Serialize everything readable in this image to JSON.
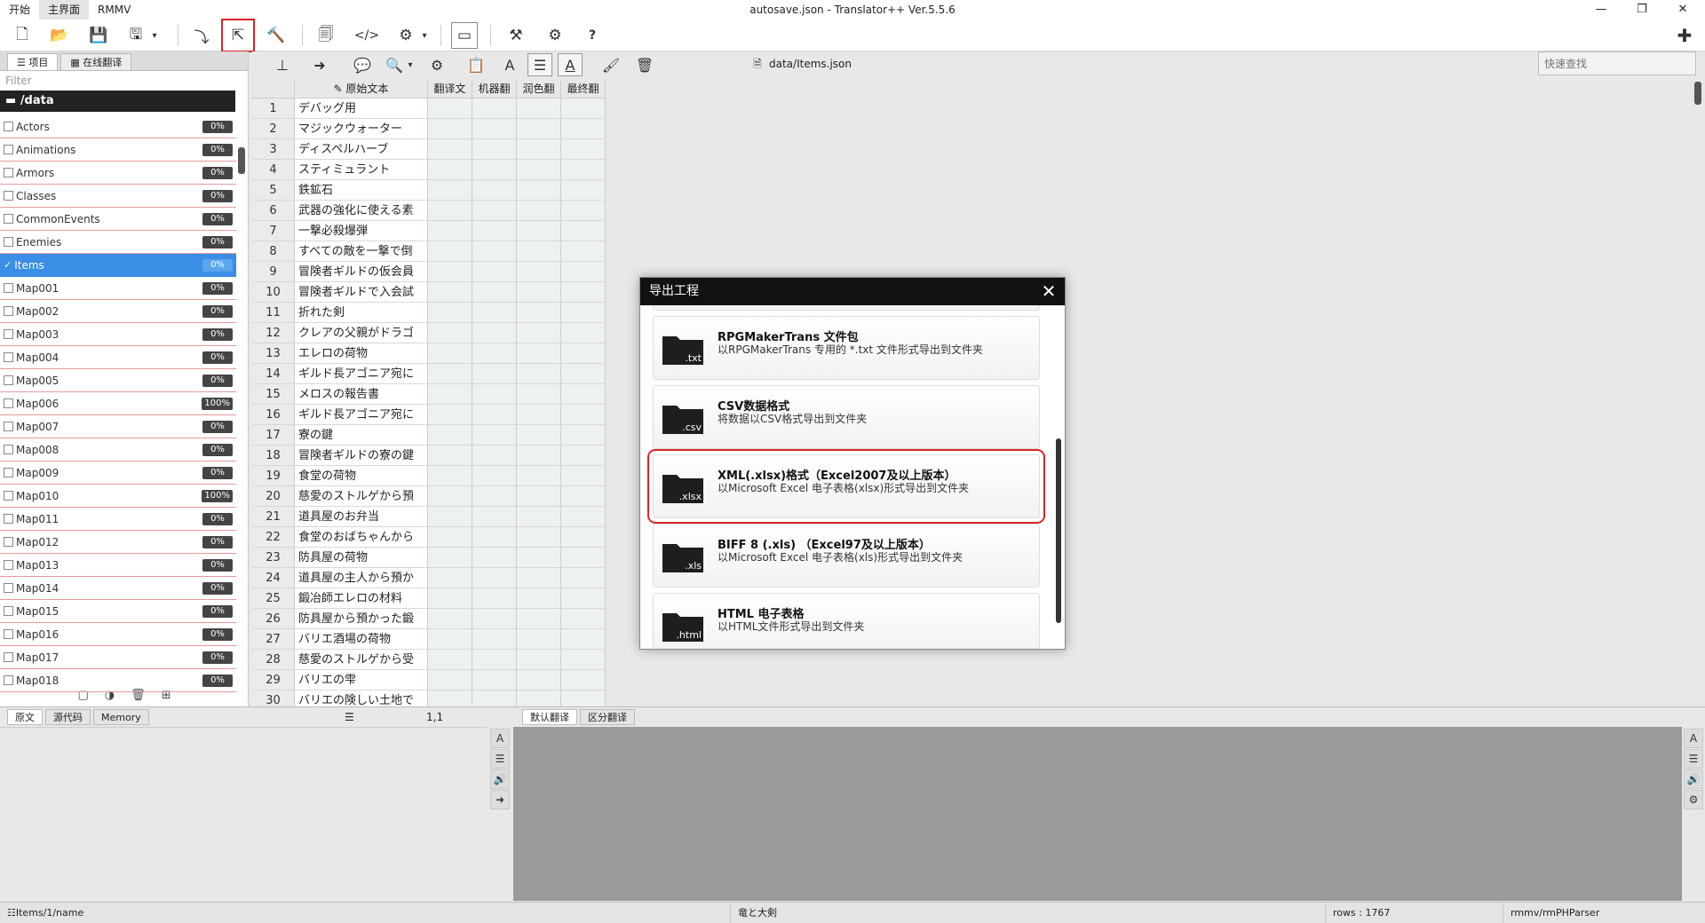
{
  "menu": {
    "items": [
      "开始",
      "主界面",
      "RMMV"
    ]
  },
  "window": {
    "title": "autosave.json - Translator++ Ver.5.5.6"
  },
  "left": {
    "tabs": [
      "项目",
      "在线翻译"
    ],
    "filter_placeholder": "Filter",
    "folder": "/data",
    "files": [
      {
        "name": "Actors",
        "pct": "0%"
      },
      {
        "name": "Animations",
        "pct": "0%"
      },
      {
        "name": "Armors",
        "pct": "0%"
      },
      {
        "name": "Classes",
        "pct": "0%"
      },
      {
        "name": "CommonEvents",
        "pct": "0%"
      },
      {
        "name": "Enemies",
        "pct": "0%"
      },
      {
        "name": "Items",
        "pct": "0%"
      },
      {
        "name": "Map001",
        "pct": "0%"
      },
      {
        "name": "Map002",
        "pct": "0%"
      },
      {
        "name": "Map003",
        "pct": "0%"
      },
      {
        "name": "Map004",
        "pct": "0%"
      },
      {
        "name": "Map005",
        "pct": "0%"
      },
      {
        "name": "Map006",
        "pct": "100%"
      },
      {
        "name": "Map007",
        "pct": "0%"
      },
      {
        "name": "Map008",
        "pct": "0%"
      },
      {
        "name": "Map009",
        "pct": "0%"
      },
      {
        "name": "Map010",
        "pct": "100%"
      },
      {
        "name": "Map011",
        "pct": "0%"
      },
      {
        "name": "Map012",
        "pct": "0%"
      },
      {
        "name": "Map013",
        "pct": "0%"
      },
      {
        "name": "Map014",
        "pct": "0%"
      },
      {
        "name": "Map015",
        "pct": "0%"
      },
      {
        "name": "Map016",
        "pct": "0%"
      },
      {
        "name": "Map017",
        "pct": "0%"
      },
      {
        "name": "Map018",
        "pct": "0%"
      }
    ]
  },
  "toolbar2": {
    "path": "data/Items.json",
    "quick_search_placeholder": "快速查找"
  },
  "grid": {
    "headers": [
      "原始文本",
      "翻译文",
      "机器翻",
      "润色翻",
      "最终翻"
    ],
    "rows": [
      {
        "n": "1",
        "src": "デバッグ用"
      },
      {
        "n": "2",
        "src": "マジックウォーター"
      },
      {
        "n": "3",
        "src": "ディスペルハーブ"
      },
      {
        "n": "4",
        "src": "スティミュラント"
      },
      {
        "n": "5",
        "src": "鉄鉱石"
      },
      {
        "n": "6",
        "src": "武器の強化に使える素"
      },
      {
        "n": "7",
        "src": "一撃必殺爆弾"
      },
      {
        "n": "8",
        "src": "すべての敵を一撃で倒"
      },
      {
        "n": "9",
        "src": "冒険者ギルドの仮会員"
      },
      {
        "n": "10",
        "src": "冒険者ギルドで入会試"
      },
      {
        "n": "11",
        "src": "折れた剣"
      },
      {
        "n": "12",
        "src": "クレアの父親がドラゴ"
      },
      {
        "n": "13",
        "src": "エレロの荷物"
      },
      {
        "n": "14",
        "src": "ギルド長アゴニア宛に"
      },
      {
        "n": "15",
        "src": "メロスの報告書"
      },
      {
        "n": "16",
        "src": "ギルド長アゴニア宛に"
      },
      {
        "n": "17",
        "src": "寮の鍵"
      },
      {
        "n": "18",
        "src": "冒険者ギルドの寮の鍵"
      },
      {
        "n": "19",
        "src": "食堂の荷物"
      },
      {
        "n": "20",
        "src": "慈愛のストルゲから預"
      },
      {
        "n": "21",
        "src": "道具屋のお弁当"
      },
      {
        "n": "22",
        "src": "食堂のおばちゃんから"
      },
      {
        "n": "23",
        "src": "防具屋の荷物"
      },
      {
        "n": "24",
        "src": "道具屋の主人から預か"
      },
      {
        "n": "25",
        "src": "鍛冶師エレロの材料"
      },
      {
        "n": "26",
        "src": "防具屋から預かった鍛"
      },
      {
        "n": "27",
        "src": "バリエ酒場の荷物"
      },
      {
        "n": "28",
        "src": "慈愛のストルゲから受"
      },
      {
        "n": "29",
        "src": "バリエの雫"
      },
      {
        "n": "30",
        "src": "バリエの険しい土地で"
      }
    ]
  },
  "bottom": {
    "left_tabs": [
      "原文",
      "源代码",
      "Memory"
    ],
    "rowcol": "1,1",
    "right_tabs": [
      "默认翻译",
      "区分翻译"
    ]
  },
  "status": {
    "path": "Items/1/name",
    "middle": "竜と大剣",
    "rows": "rows : 1767",
    "parser": "rmmv/rmPHParser"
  },
  "dialog": {
    "title": "导出工程",
    "options": [
      {
        "ext": ".txt",
        "title": "RPGMakerTrans 文件包",
        "desc": "以RPGMakerTrans 专用的 *.txt 文件形式导出到文件夹"
      },
      {
        "ext": ".csv",
        "title": "CSV数据格式",
        "desc": "将数据以CSV格式导出到文件夹"
      },
      {
        "ext": ".xlsx",
        "title": "XML(.xlsx)格式（Excel2007及以上版本）",
        "desc": "以Microsoft Excel 电子表格(xlsx)形式导出到文件夹"
      },
      {
        "ext": ".xls",
        "title": "BIFF 8 (.xls) （Excel97及以上版本）",
        "desc": "以Microsoft Excel 电子表格(xls)形式导出到文件夹"
      },
      {
        "ext": ".html",
        "title": "HTML 电子表格",
        "desc": "以HTML文件形式导出到文件夹"
      }
    ]
  }
}
